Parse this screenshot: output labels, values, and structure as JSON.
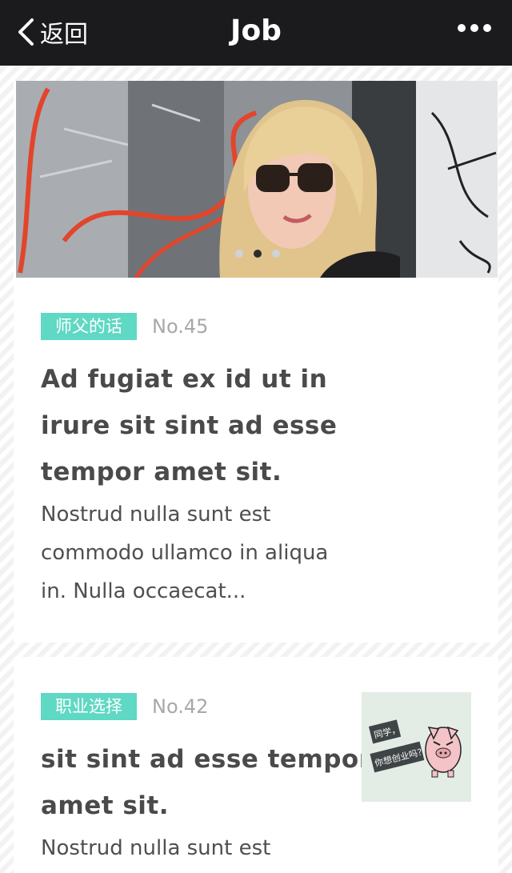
{
  "nav": {
    "back_label": "返回",
    "title": "Job"
  },
  "articles": [
    {
      "tag": "师父的话",
      "number": "No.45",
      "headline_lines": [
        "Ad fugiat ex id ut in",
        "irure sit sint ad esse",
        "tempor amet sit."
      ],
      "excerpt_lines": [
        "Nostrud nulla sunt est",
        "commodo ullamco in aliqua",
        "in. Nulla occaecat..."
      ]
    },
    {
      "tag": "职业选择",
      "number": "No.42",
      "headline_lines": [
        "sit sint ad esse tempor",
        "amet sit."
      ],
      "excerpt_lines": [
        "Nostrud nulla sunt est"
      ],
      "thumb_text_lines": [
        "同学，",
        "你想创业吗？"
      ]
    }
  ],
  "carousel": {
    "count": 3,
    "active_index": 1
  },
  "colors": {
    "nav_bg": "#1b1b1d",
    "tag_bg": "#5fd8c4",
    "headline": "#4a4a4a"
  }
}
